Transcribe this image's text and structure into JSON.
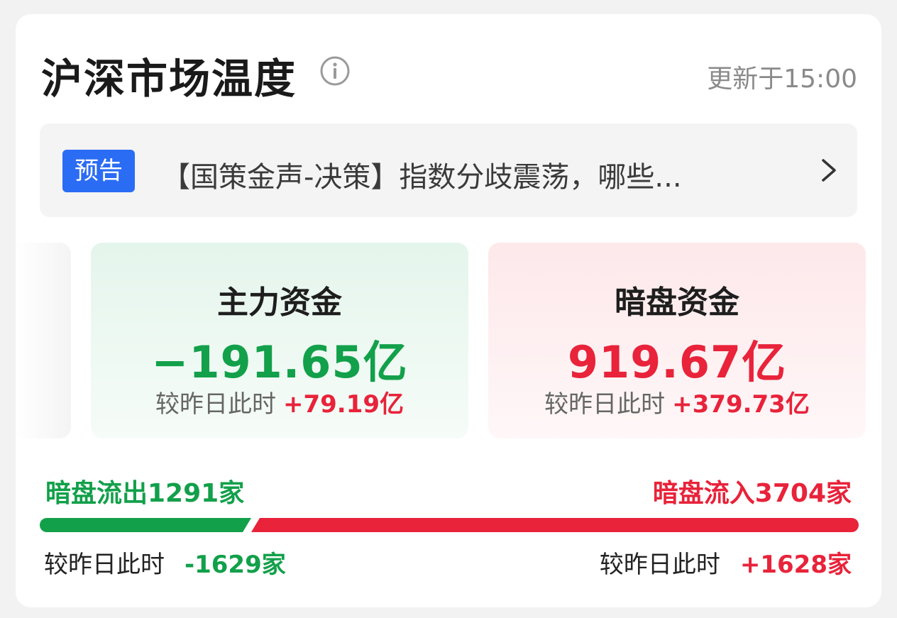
{
  "header": {
    "title": "沪深市场温度",
    "update_time": "更新于15:00"
  },
  "notice": {
    "badge": "预告",
    "text": "【国策金声-决策】指数分歧震荡，哪些..."
  },
  "main_fund": {
    "label": "主力资金",
    "value": "−191.65亿",
    "compare_label": "较昨日此时",
    "compare_delta": "+79.19亿"
  },
  "dark_fund": {
    "label": "暗盘资金",
    "value": "919.67亿",
    "compare_label": "较昨日此时",
    "compare_delta": "+379.73亿"
  },
  "flow": {
    "out_label": "暗盘流出1291家",
    "in_label": "暗盘流入3704家",
    "out_count": 1291,
    "in_count": 3704,
    "out_compare_label": "较昨日此时",
    "out_compare_delta": "-1629家",
    "in_compare_label": "较昨日此时",
    "in_compare_delta": "+1628家"
  },
  "colors": {
    "green": "#12a04a",
    "red": "#e8233a",
    "badge_blue": "#2b6cf5"
  },
  "icons": {
    "info": "info-icon",
    "chevron": "chevron-right-icon"
  }
}
